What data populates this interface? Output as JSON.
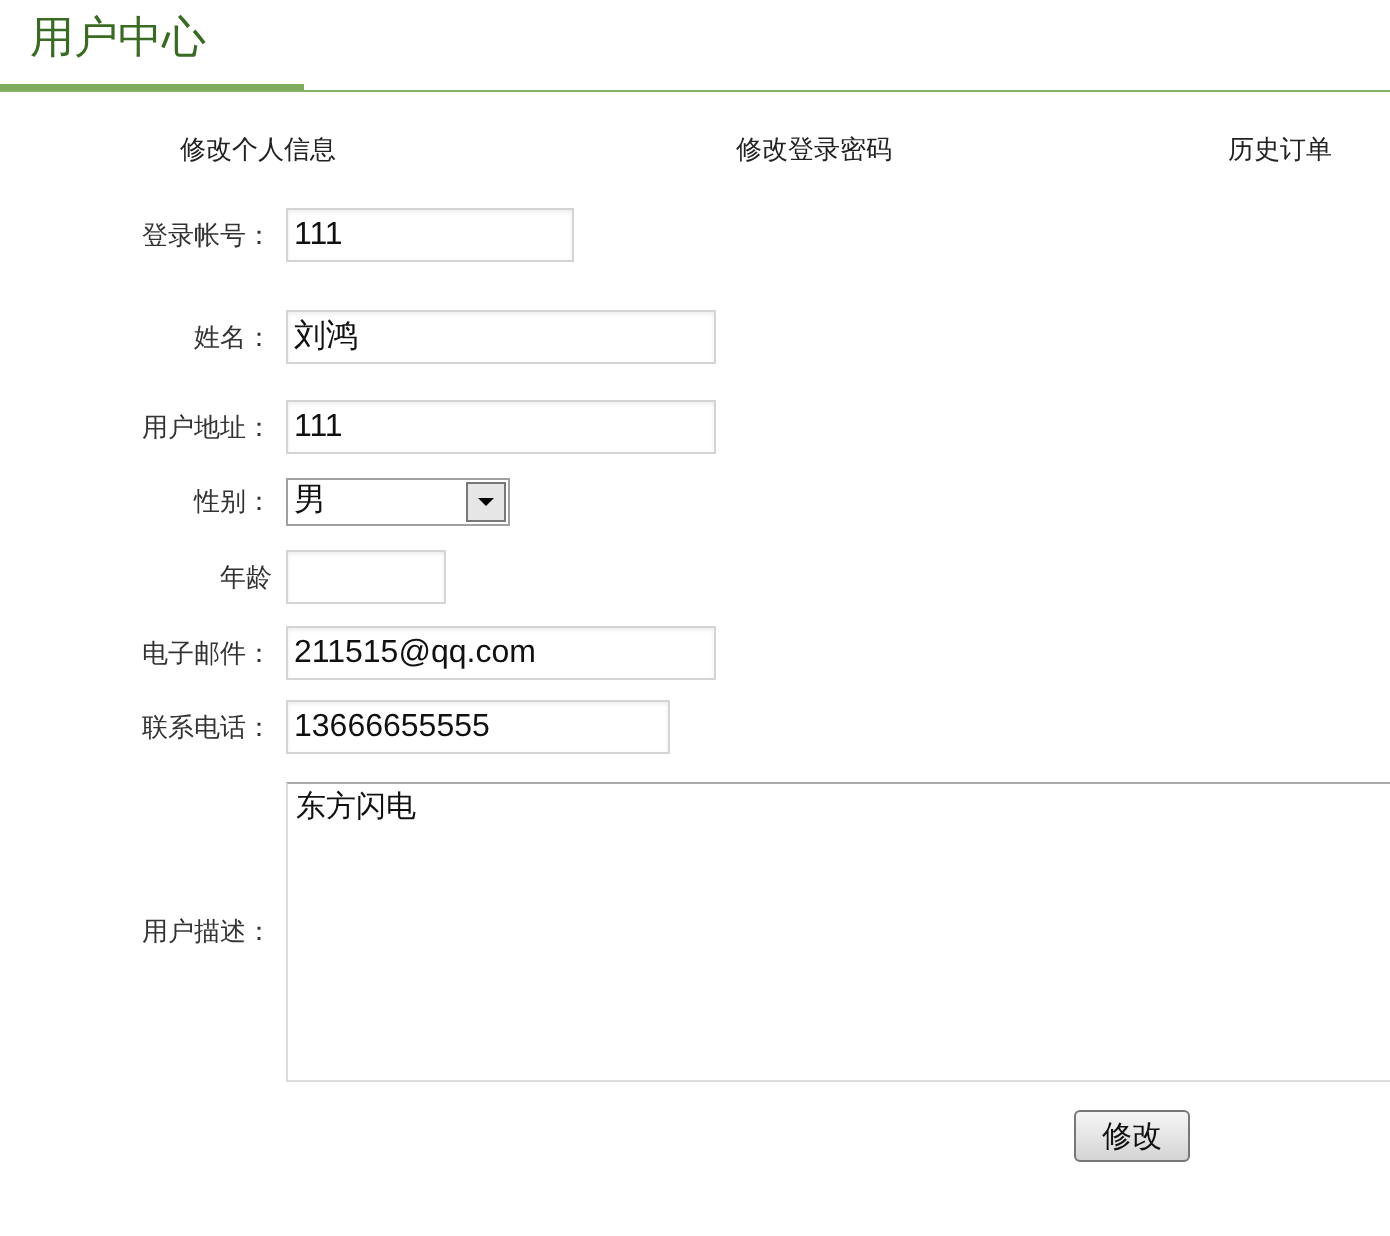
{
  "header": {
    "title": "用户中心"
  },
  "nav": [
    {
      "label": "修改个人信息"
    },
    {
      "label": "修改登录密码"
    },
    {
      "label": "历史订单"
    }
  ],
  "form": {
    "fields": [
      {
        "kind": "text",
        "label": "登录帐号：",
        "value": "111"
      },
      {
        "kind": "text",
        "label": "姓名：",
        "value": "刘鸿"
      },
      {
        "kind": "text",
        "label": "用户地址：",
        "value": "111"
      },
      {
        "kind": "select",
        "label": "性别：",
        "value": "男"
      },
      {
        "kind": "text",
        "label": "年龄"
      },
      {
        "kind": "text",
        "label": "电子邮件：",
        "value": "211515@qq.com"
      },
      {
        "kind": "text",
        "label": "联系电话：",
        "value": "13666655555"
      },
      {
        "kind": "textarea",
        "label": "用户描述：",
        "value": "东方闪电"
      }
    ]
  },
  "submit": {
    "label": "修改"
  }
}
